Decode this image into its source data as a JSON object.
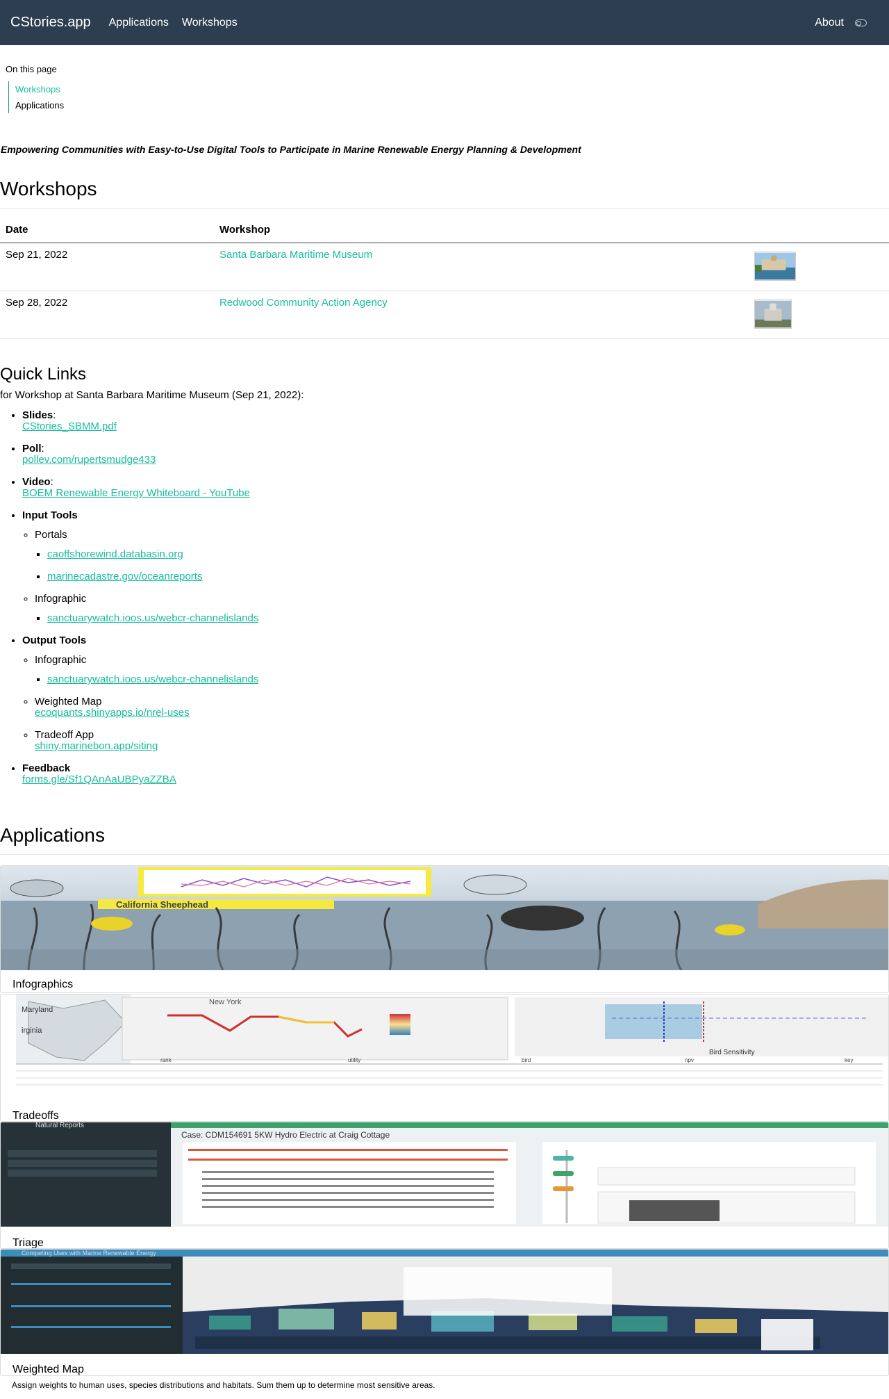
{
  "nav": {
    "brand": "CStories.app",
    "links": [
      "Applications",
      "Workshops"
    ],
    "about": "About"
  },
  "toc": {
    "title": "On this page",
    "items": [
      "Workshops",
      "Applications"
    ]
  },
  "tagline": "Empowering Communities with Easy-to-Use Digital Tools to Participate in Marine Renewable Energy Planning & Development",
  "workshops": {
    "heading": "Workshops",
    "columns": [
      "Date",
      "Workshop"
    ],
    "rows": [
      {
        "date": "Sep 21, 2022",
        "name": "Santa Barbara Maritime Museum"
      },
      {
        "date": "Sep 28, 2022",
        "name": "Redwood Community Action Agency"
      }
    ]
  },
  "quick_links": {
    "heading": "Quick Links",
    "subtitle": "for Workshop at Santa Barbara Maritime Museum (Sep 21, 2022):",
    "slides_label": "Slides",
    "slides_link": "CStories_SBMM.pdf",
    "poll_label": "Poll",
    "poll_link": "pollev.com/rupertsmudge433",
    "video_label": "Video",
    "video_link": "BOEM Renewable Energy Whiteboard - YouTube",
    "input_label": "Input Tools",
    "portals_label": "Portals",
    "portal_links": [
      "caoffshorewind.databasin.org",
      "marinecadastre.gov/oceanreports"
    ],
    "infographic_label": "Infographic",
    "infographic_link": "sanctuarywatch.ioos.us/webcr-channelislands",
    "output_label": "Output Tools",
    "out_infographic_label": "Infographic",
    "out_infographic_link": "sanctuarywatch.ioos.us/webcr-channelislands",
    "weighted_label": "Weighted Map",
    "weighted_link": "ecoquants.shinyapps.io/nrel-uses",
    "tradeoff_label": "Tradeoff App",
    "tradeoff_link": "shiny.marinebon.app/siting",
    "feedback_label": "Feedback",
    "feedback_link": "forms.gle/Sf1QAnAaUBPyaZZBA"
  },
  "applications": {
    "heading": "Applications",
    "cards": [
      {
        "title": "Infographics",
        "image_text": "California Sheephead"
      },
      {
        "title": "Tradeoffs",
        "table_header": [
          "rank",
          "utility",
          "bird",
          "npv",
          "key"
        ],
        "axis_x": "Bird Sensitivity",
        "plot_title": "New York"
      },
      {
        "title": "Triage",
        "header": "Natural Reports",
        "case": "Case: CDM154691 5KW Hydro Electric at Craig Cottage"
      },
      {
        "title": "Weighted Map",
        "header": "Competing Uses with Marine Renewable Energy",
        "desc": "Assign weights to human uses, species distributions and habitats. Sum them up to determine most sensitive areas."
      }
    ]
  },
  "colors": {
    "navbar": "#2c3e50",
    "accent": "#18bc9c"
  }
}
